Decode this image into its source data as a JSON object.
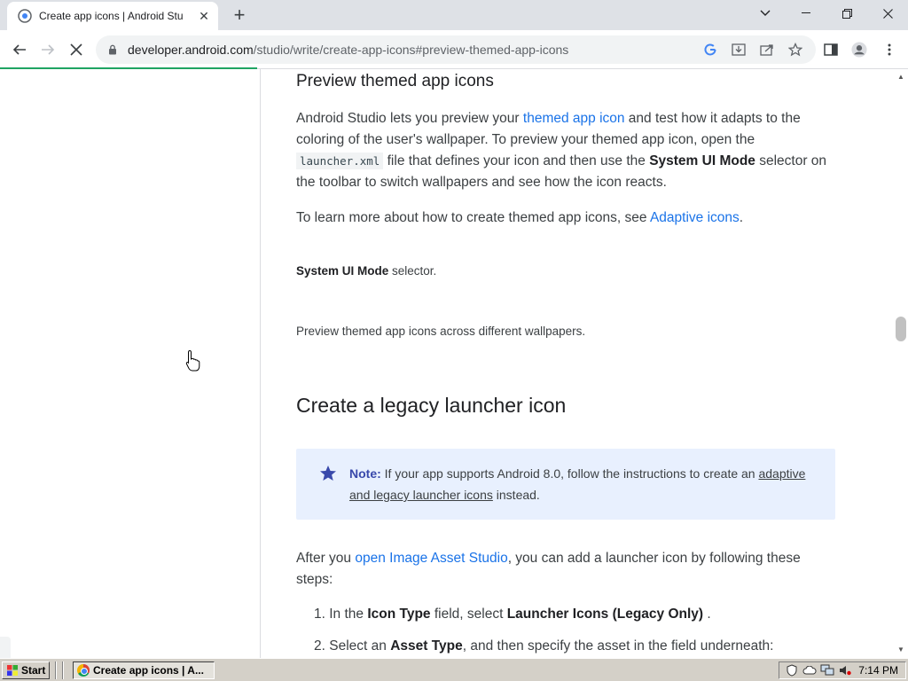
{
  "browser": {
    "tab_title": "Create app icons  |  Android Stu",
    "new_tab": "+",
    "url_host": "developer.android.com",
    "url_path": "/studio/write/create-app-icons#preview-themed-app-icons"
  },
  "article": {
    "section1_title": "Preview themed app icons",
    "p1": {
      "a": "Android Studio lets you preview your ",
      "link1": "themed app icon",
      "b": " and test how it adapts to the coloring of the user's wallpaper. To preview your themed app icon, open the ",
      "code": "launcher.xml",
      "c": " file that defines your icon and then use the ",
      "bold": "System UI Mode",
      "d": " selector on the toolbar to switch wallpapers and see how the icon reacts."
    },
    "p2": {
      "a": "To learn more about how to create themed app icons, see ",
      "link": "Adaptive icons",
      "b": "."
    },
    "caption1_bold": "System UI Mode",
    "caption1_rest": " selector.",
    "caption2": "Preview themed app icons across different wallpapers.",
    "section2_title": "Create a legacy launcher icon",
    "note": {
      "label": "Note:",
      "text": " If your app supports Android 8.0, follow the instructions to create an ",
      "link": "adaptive and legacy launcher icons",
      "end": " instead."
    },
    "p3": {
      "a": "After you ",
      "link": "open Image Asset Studio",
      "b": ", you can add a launcher icon by following these steps:"
    },
    "step1": {
      "num": "1.",
      "a": "In the ",
      "bold1": "Icon Type",
      "b": " field, select ",
      "bold2": "Launcher Icons (Legacy Only)",
      "c": " ."
    },
    "step2": {
      "num": "2.",
      "a": "Select an ",
      "bold": "Asset Type",
      "b": ", and then specify the asset in the field underneath:"
    }
  },
  "taskbar": {
    "start": "Start",
    "task": "Create app icons  |  A...",
    "clock": "7:14 PM"
  },
  "colors": {
    "link": "#1a73e8",
    "note_bg": "#e8f0fe",
    "star": "#3949ab",
    "progress": "#1fa463"
  }
}
